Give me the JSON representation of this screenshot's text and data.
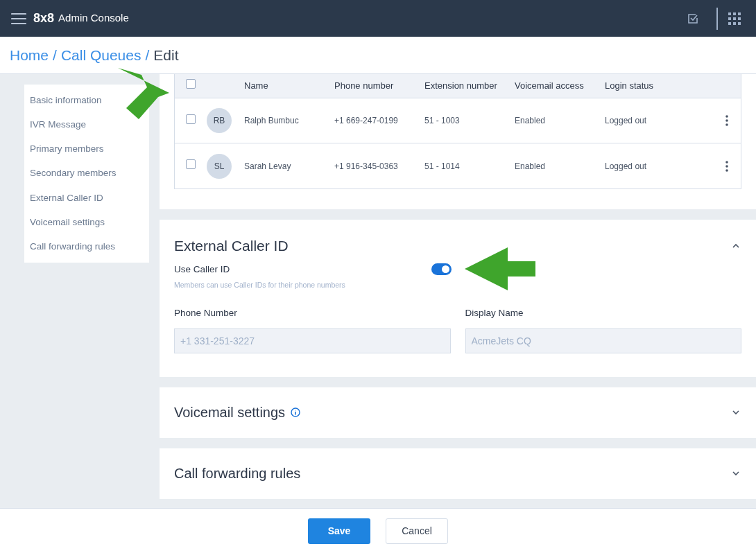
{
  "header": {
    "brand": "8x8",
    "title": "Admin Console"
  },
  "breadcrumb_separator": "/",
  "breadcrumb": [
    {
      "label": "Home",
      "link": true
    },
    {
      "label": "Call Queues",
      "link": true
    },
    {
      "label": "Edit",
      "link": false
    }
  ],
  "sidebar": {
    "items": [
      {
        "label": "Basic information"
      },
      {
        "label": "IVR Message"
      },
      {
        "label": "Primary members"
      },
      {
        "label": "Secondary members"
      },
      {
        "label": "External Caller ID"
      },
      {
        "label": "Voicemail settings"
      },
      {
        "label": "Call forwarding rules"
      }
    ]
  },
  "members_table": {
    "select_all_checked": false,
    "columns": [
      "Name",
      "Phone number",
      "Extension number",
      "Voicemail access",
      "Login status"
    ],
    "rows": [
      {
        "checked": false,
        "initials": "RB",
        "name": "Ralph Bumbuc",
        "phone": "+1 669-247-0199",
        "extension": "51 - 1003",
        "voicemail": "Enabled",
        "login": "Logged out"
      },
      {
        "checked": false,
        "initials": "SL",
        "name": "Sarah Levay",
        "phone": "+1 916-345-0363",
        "extension": "51 - 1014",
        "voicemail": "Enabled",
        "login": "Logged out"
      }
    ]
  },
  "external_caller_id": {
    "title": "External Caller ID",
    "expanded": true,
    "toggle_label": "Use Caller ID",
    "toggle_on": true,
    "hint": "Members can use Caller IDs for their phone numbers",
    "fields": [
      {
        "label": "Phone Number",
        "placeholder": "+1 331-251-3227"
      },
      {
        "label": "Display Name",
        "placeholder": "AcmeJets CQ"
      }
    ]
  },
  "sections": [
    {
      "title": "Voicemail settings",
      "info": true,
      "expanded": false
    },
    {
      "title": "Call forwarding rules",
      "info": false,
      "expanded": false
    }
  ],
  "buttons": [
    {
      "label": "Save",
      "kind": "primary"
    },
    {
      "label": "Cancel",
      "kind": "secondary"
    }
  ]
}
